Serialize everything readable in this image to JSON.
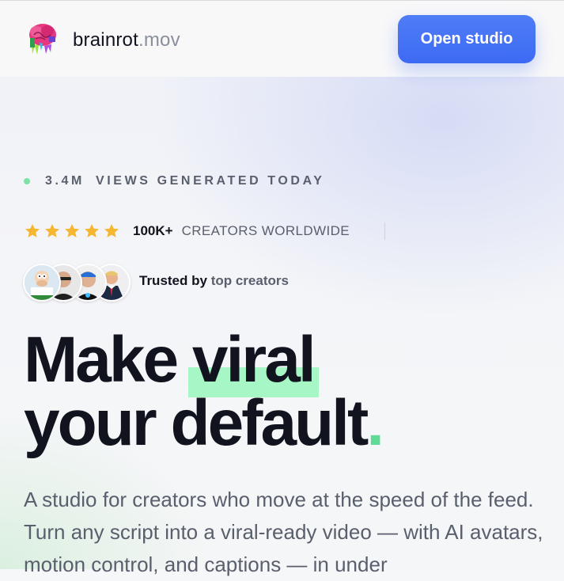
{
  "brand": {
    "name_main": "brainrot",
    "name_ext": ".mov",
    "logo_icon": "brain-logo-icon"
  },
  "nav": {
    "cta_label": "Open studio"
  },
  "hero": {
    "live_count": "3.4M",
    "live_text": "VIEWS GENERATED TODAY",
    "rating": {
      "stars": 5,
      "max": 5
    },
    "creators_count": "100K+",
    "creators_label": "CREATORS WORLDWIDE",
    "trusted_prefix": "Trusted by",
    "trusted_suffix": "top creators",
    "headline_make": "Make",
    "headline_viral": "viral",
    "headline_line2": "your default",
    "headline_dot": ".",
    "subtext": "A studio for creators who move at the speed of the feed. Turn any script into a viral-ready video — with AI avatars, motion control, and captions — in under"
  },
  "colors": {
    "accent_blue": "#3d6af3",
    "accent_green": "#a7f6c6",
    "dot_green": "#5fdb97",
    "star": "#f5b731"
  }
}
